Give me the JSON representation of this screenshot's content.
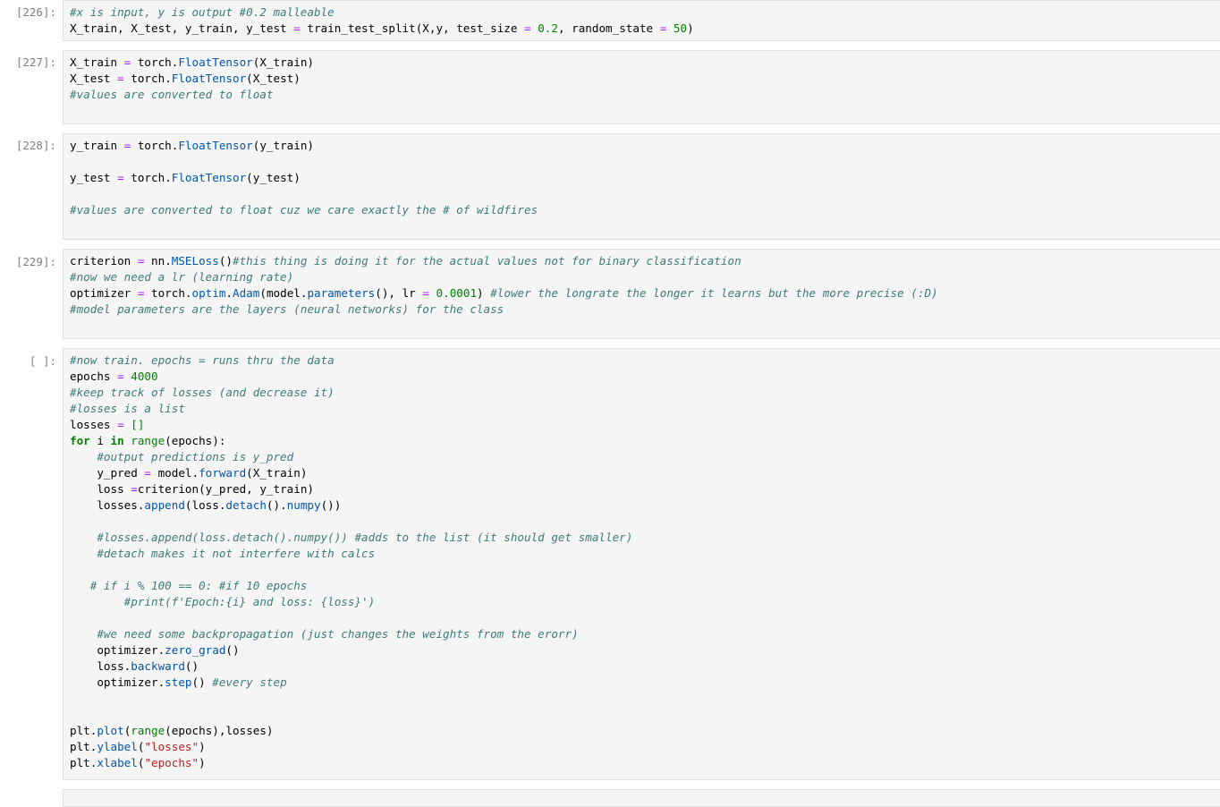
{
  "cells": [
    {
      "prompt": "[226]:",
      "lines": [
        [
          [
            "c",
            "#x is input, y is output #0.2 malleable"
          ]
        ],
        [
          [
            "t",
            "X_train, X_test, y_train, y_test "
          ],
          [
            "o",
            "="
          ],
          [
            "t",
            " train_test_split(X,y, test_size "
          ],
          [
            "o",
            "="
          ],
          [
            "t",
            " "
          ],
          [
            "n",
            "0.2"
          ],
          [
            "t",
            ", random_state "
          ],
          [
            "o",
            "="
          ],
          [
            "t",
            " "
          ],
          [
            "n",
            "50"
          ],
          [
            "t",
            ")"
          ]
        ]
      ]
    },
    {
      "prompt": "[227]:",
      "lines": [
        [
          [
            "t",
            "X_train "
          ],
          [
            "o",
            "="
          ],
          [
            "t",
            " torch."
          ],
          [
            "f",
            "FloatTensor"
          ],
          [
            "t",
            "(X_train)"
          ]
        ],
        [
          [
            "t",
            "X_test "
          ],
          [
            "o",
            "="
          ],
          [
            "t",
            " torch."
          ],
          [
            "f",
            "FloatTensor"
          ],
          [
            "t",
            "(X_test)"
          ]
        ],
        [
          [
            "c",
            "#values are converted to float"
          ]
        ]
      ]
    },
    {
      "prompt": "[228]:",
      "lines": [
        [
          [
            "t",
            "y_train "
          ],
          [
            "o",
            "="
          ],
          [
            "t",
            " torch."
          ],
          [
            "f",
            "FloatTensor"
          ],
          [
            "t",
            "(y_train)"
          ]
        ],
        [],
        [
          [
            "t",
            "y_test "
          ],
          [
            "o",
            "="
          ],
          [
            "t",
            " torch."
          ],
          [
            "f",
            "FloatTensor"
          ],
          [
            "t",
            "(y_test)"
          ]
        ],
        [],
        [
          [
            "c",
            "#values are converted to float cuz we care exactly the # of wildfires"
          ]
        ]
      ]
    },
    {
      "prompt": "[229]:",
      "lines": [
        [
          [
            "t",
            "criterion "
          ],
          [
            "o",
            "="
          ],
          [
            "t",
            " nn."
          ],
          [
            "f",
            "MSELoss"
          ],
          [
            "t",
            "()"
          ],
          [
            "c",
            "#this thing is doing it for the actual values not for binary classification"
          ]
        ],
        [
          [
            "c",
            "#now we need a lr (learning rate)"
          ]
        ],
        [
          [
            "t",
            "optimizer "
          ],
          [
            "o",
            "="
          ],
          [
            "t",
            " torch."
          ],
          [
            "f",
            "optim"
          ],
          [
            "t",
            "."
          ],
          [
            "f",
            "Adam"
          ],
          [
            "t",
            "(model."
          ],
          [
            "f",
            "parameters"
          ],
          [
            "t",
            "(), lr "
          ],
          [
            "o",
            "="
          ],
          [
            "t",
            " "
          ],
          [
            "n",
            "0.0001"
          ],
          [
            "t",
            ") "
          ],
          [
            "c",
            "#lower the longrate the longer it learns but the more precise (:D)"
          ]
        ],
        [
          [
            "c",
            "#model parameters are the layers (neural networks) for the class"
          ]
        ]
      ]
    },
    {
      "prompt": "[ ]:",
      "lines": [
        [
          [
            "c",
            "#now train. epochs = runs thru the data"
          ]
        ],
        [
          [
            "t",
            "epochs "
          ],
          [
            "o",
            "="
          ],
          [
            "t",
            " "
          ],
          [
            "n",
            "4000"
          ]
        ],
        [
          [
            "c",
            "#keep track of losses (and decrease it)"
          ]
        ],
        [
          [
            "c",
            "#losses is a list"
          ]
        ],
        [
          [
            "t",
            "losses "
          ],
          [
            "o",
            "="
          ],
          [
            "t",
            " "
          ],
          [
            "n",
            "[]"
          ]
        ],
        [
          [
            "k",
            "for"
          ],
          [
            "t",
            " i "
          ],
          [
            "k",
            "in"
          ],
          [
            "t",
            " "
          ],
          [
            "b",
            "range"
          ],
          [
            "t",
            "(epochs):"
          ]
        ],
        [
          [
            "t",
            "    "
          ],
          [
            "c",
            "#output predictions is y_pred"
          ]
        ],
        [
          [
            "t",
            "    y_pred "
          ],
          [
            "o",
            "="
          ],
          [
            "t",
            " model."
          ],
          [
            "f",
            "forward"
          ],
          [
            "t",
            "(X_train)"
          ]
        ],
        [
          [
            "t",
            "    loss "
          ],
          [
            "o",
            "="
          ],
          [
            "t",
            "criterion(y_pred, y_train)"
          ]
        ],
        [
          [
            "t",
            "    losses."
          ],
          [
            "f",
            "append"
          ],
          [
            "t",
            "(loss."
          ],
          [
            "f",
            "detach"
          ],
          [
            "t",
            "()."
          ],
          [
            "f",
            "numpy"
          ],
          [
            "t",
            "())"
          ]
        ],
        [],
        [
          [
            "t",
            "    "
          ],
          [
            "c",
            "#losses.append(loss.detach().numpy()) #adds to the list (it should get smaller)"
          ]
        ],
        [
          [
            "t",
            "    "
          ],
          [
            "c",
            "#detach makes it not interfere with calcs"
          ]
        ],
        [],
        [
          [
            "t",
            "   "
          ],
          [
            "c",
            "# if i % 100 == 0: #if 10 epochs"
          ]
        ],
        [
          [
            "t",
            "        "
          ],
          [
            "c",
            "#print(f'Epoch:{i} and loss: {loss}')"
          ]
        ],
        [],
        [
          [
            "t",
            "    "
          ],
          [
            "c",
            "#we need some backpropagation (just changes the weights from the erorr)"
          ]
        ],
        [
          [
            "t",
            "    optimizer."
          ],
          [
            "f",
            "zero_grad"
          ],
          [
            "t",
            "()"
          ]
        ],
        [
          [
            "t",
            "    loss."
          ],
          [
            "f",
            "backward"
          ],
          [
            "t",
            "()"
          ]
        ],
        [
          [
            "t",
            "    optimizer."
          ],
          [
            "f",
            "step"
          ],
          [
            "t",
            "() "
          ],
          [
            "c",
            "#every step"
          ]
        ],
        [],
        [],
        [
          [
            "t",
            "plt."
          ],
          [
            "f",
            "plot"
          ],
          [
            "t",
            "("
          ],
          [
            "b",
            "range"
          ],
          [
            "t",
            "(epochs),losses)"
          ]
        ],
        [
          [
            "t",
            "plt."
          ],
          [
            "f",
            "ylabel"
          ],
          [
            "t",
            "("
          ],
          [
            "s",
            "\"losses\""
          ],
          [
            "t",
            ")"
          ]
        ],
        [
          [
            "t",
            "plt."
          ],
          [
            "f",
            "xlabel"
          ],
          [
            "t",
            "("
          ],
          [
            "s",
            "\"epochs\""
          ],
          [
            "t",
            ")"
          ]
        ]
      ]
    }
  ]
}
